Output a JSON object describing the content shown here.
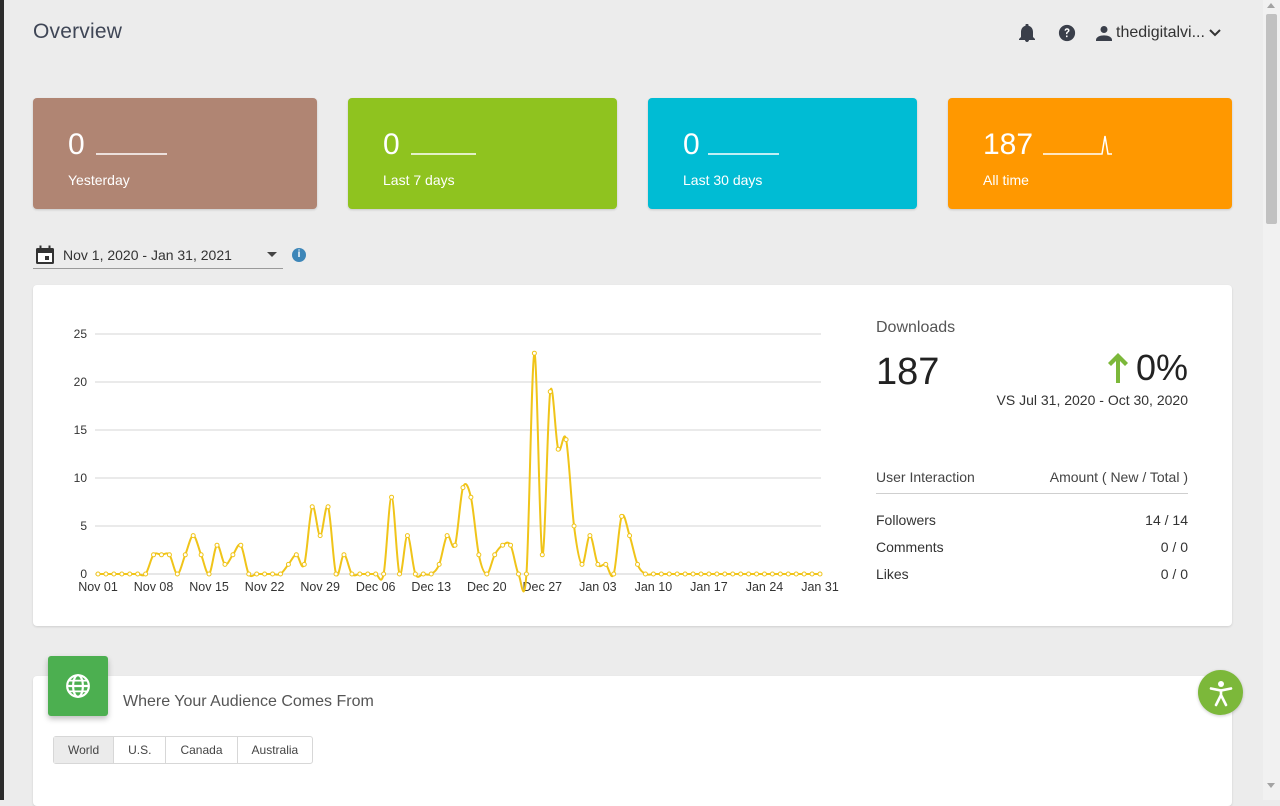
{
  "header": {
    "title": "Overview",
    "notifications_icon": "bell-icon",
    "help_icon": "help-icon",
    "user_icon": "person-icon",
    "username": "thedigitalvi...",
    "dropdown_icon": "chevron-down-icon"
  },
  "stats": [
    {
      "value": "0",
      "label": "Yesterday",
      "color": "#b08573"
    },
    {
      "value": "0",
      "label": "Last 7 days",
      "color": "#8fc31f"
    },
    {
      "value": "0",
      "label": "Last 30 days",
      "color": "#00bcd4"
    },
    {
      "value": "187",
      "label": "All time",
      "color": "#ff9800"
    }
  ],
  "date_range": {
    "calendar_icon": "calendar-icon",
    "value": "Nov 1, 2020 - Jan 31, 2021",
    "info_icon": "info-icon",
    "info_glyph": "i"
  },
  "downloads": {
    "label": "Downloads",
    "total": "187",
    "trend_icon": "arrow-up-icon",
    "change": "0%",
    "compare": "VS Jul 31, 2020 - Oct 30, 2020"
  },
  "interaction": {
    "header_left": "User Interaction",
    "header_right": "Amount ( New / Total )",
    "rows": [
      {
        "label": "Followers",
        "value": "14 / 14"
      },
      {
        "label": "Comments",
        "value": "0 / 0"
      },
      {
        "label": "Likes",
        "value": "0 / 0"
      }
    ]
  },
  "audience": {
    "icon": "globe-icon",
    "title": "Where Your Audience Comes From",
    "tabs": [
      "World",
      "U.S.",
      "Canada",
      "Australia"
    ],
    "active_tab": "World"
  },
  "accessibility_icon": "accessibility-icon",
  "colors": {
    "line": "#f0c419"
  },
  "chart_data": {
    "type": "line",
    "title": "",
    "xlabel": "",
    "ylabel": "",
    "ylim": [
      0,
      25
    ],
    "yticks": [
      0,
      5,
      10,
      15,
      20,
      25
    ],
    "xtick_labels": [
      "Nov 01",
      "Nov 08",
      "Nov 15",
      "Nov 22",
      "Nov 29",
      "Dec 06",
      "Dec 13",
      "Dec 20",
      "Dec 27",
      "Jan 03",
      "Jan 10",
      "Jan 17",
      "Jan 24",
      "Jan 31"
    ],
    "grid": true,
    "legend": "none",
    "series": [
      {
        "values": [
          0,
          0,
          0,
          0,
          0,
          0,
          0,
          2,
          2,
          2,
          0,
          2,
          4,
          2,
          0,
          3,
          1,
          2,
          3,
          0,
          0,
          0,
          0,
          0,
          1,
          2,
          1,
          7,
          4,
          7,
          0,
          2,
          0,
          0,
          0,
          0,
          0,
          8,
          0,
          4,
          0,
          0,
          0,
          1,
          4,
          3,
          9,
          8,
          2,
          0,
          2,
          3,
          3,
          0,
          0,
          23,
          2,
          19,
          13,
          14,
          5,
          1,
          4,
          1,
          1,
          0,
          6,
          4,
          1,
          0,
          0,
          0,
          0,
          0,
          0,
          0,
          0,
          0,
          0,
          0,
          0,
          0,
          0,
          0,
          0,
          0,
          0,
          0,
          0,
          0,
          0,
          0
        ]
      }
    ]
  }
}
